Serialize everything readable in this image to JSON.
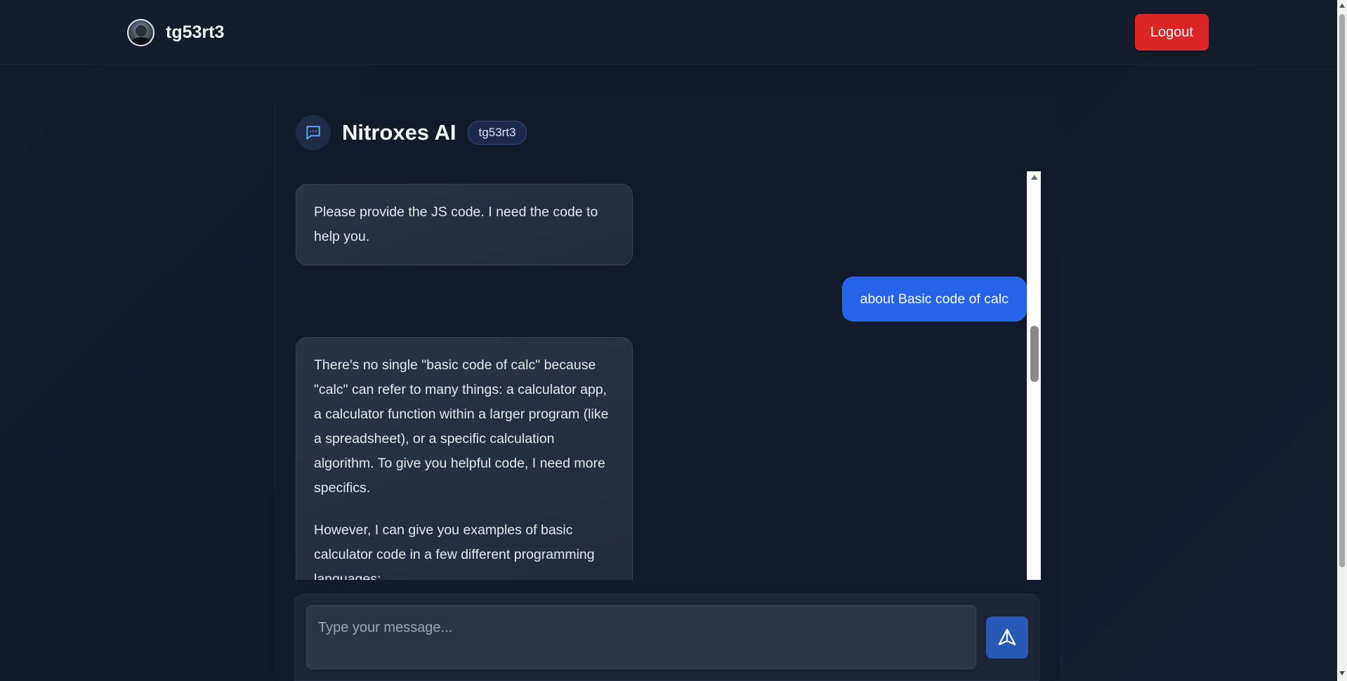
{
  "topbar": {
    "username": "tg53rt3",
    "logout_label": "Logout"
  },
  "chat": {
    "title": "Nitroxes AI",
    "user_badge": "tg53rt3",
    "messages": [
      {
        "role": "ai",
        "paragraphs": [
          "Please provide the JS code. I need the code to help you."
        ]
      },
      {
        "role": "user",
        "text": "about Basic code of calc"
      },
      {
        "role": "ai",
        "paragraphs": [
          "There's no single \"basic code of calc\" because \"calc\" can refer to many things: a calculator app, a calculator function within a larger program (like a spreadsheet), or a specific calculation algorithm. To give you helpful code, I need more specifics.",
          "However, I can give you examples of basic calculator code in a few different programming languages:"
        ]
      }
    ]
  },
  "composer": {
    "placeholder": "Type your message...",
    "send_icon": "send-icon"
  },
  "colors": {
    "accent": "#2563eb",
    "logout": "#dc2626",
    "background": "#111827"
  }
}
